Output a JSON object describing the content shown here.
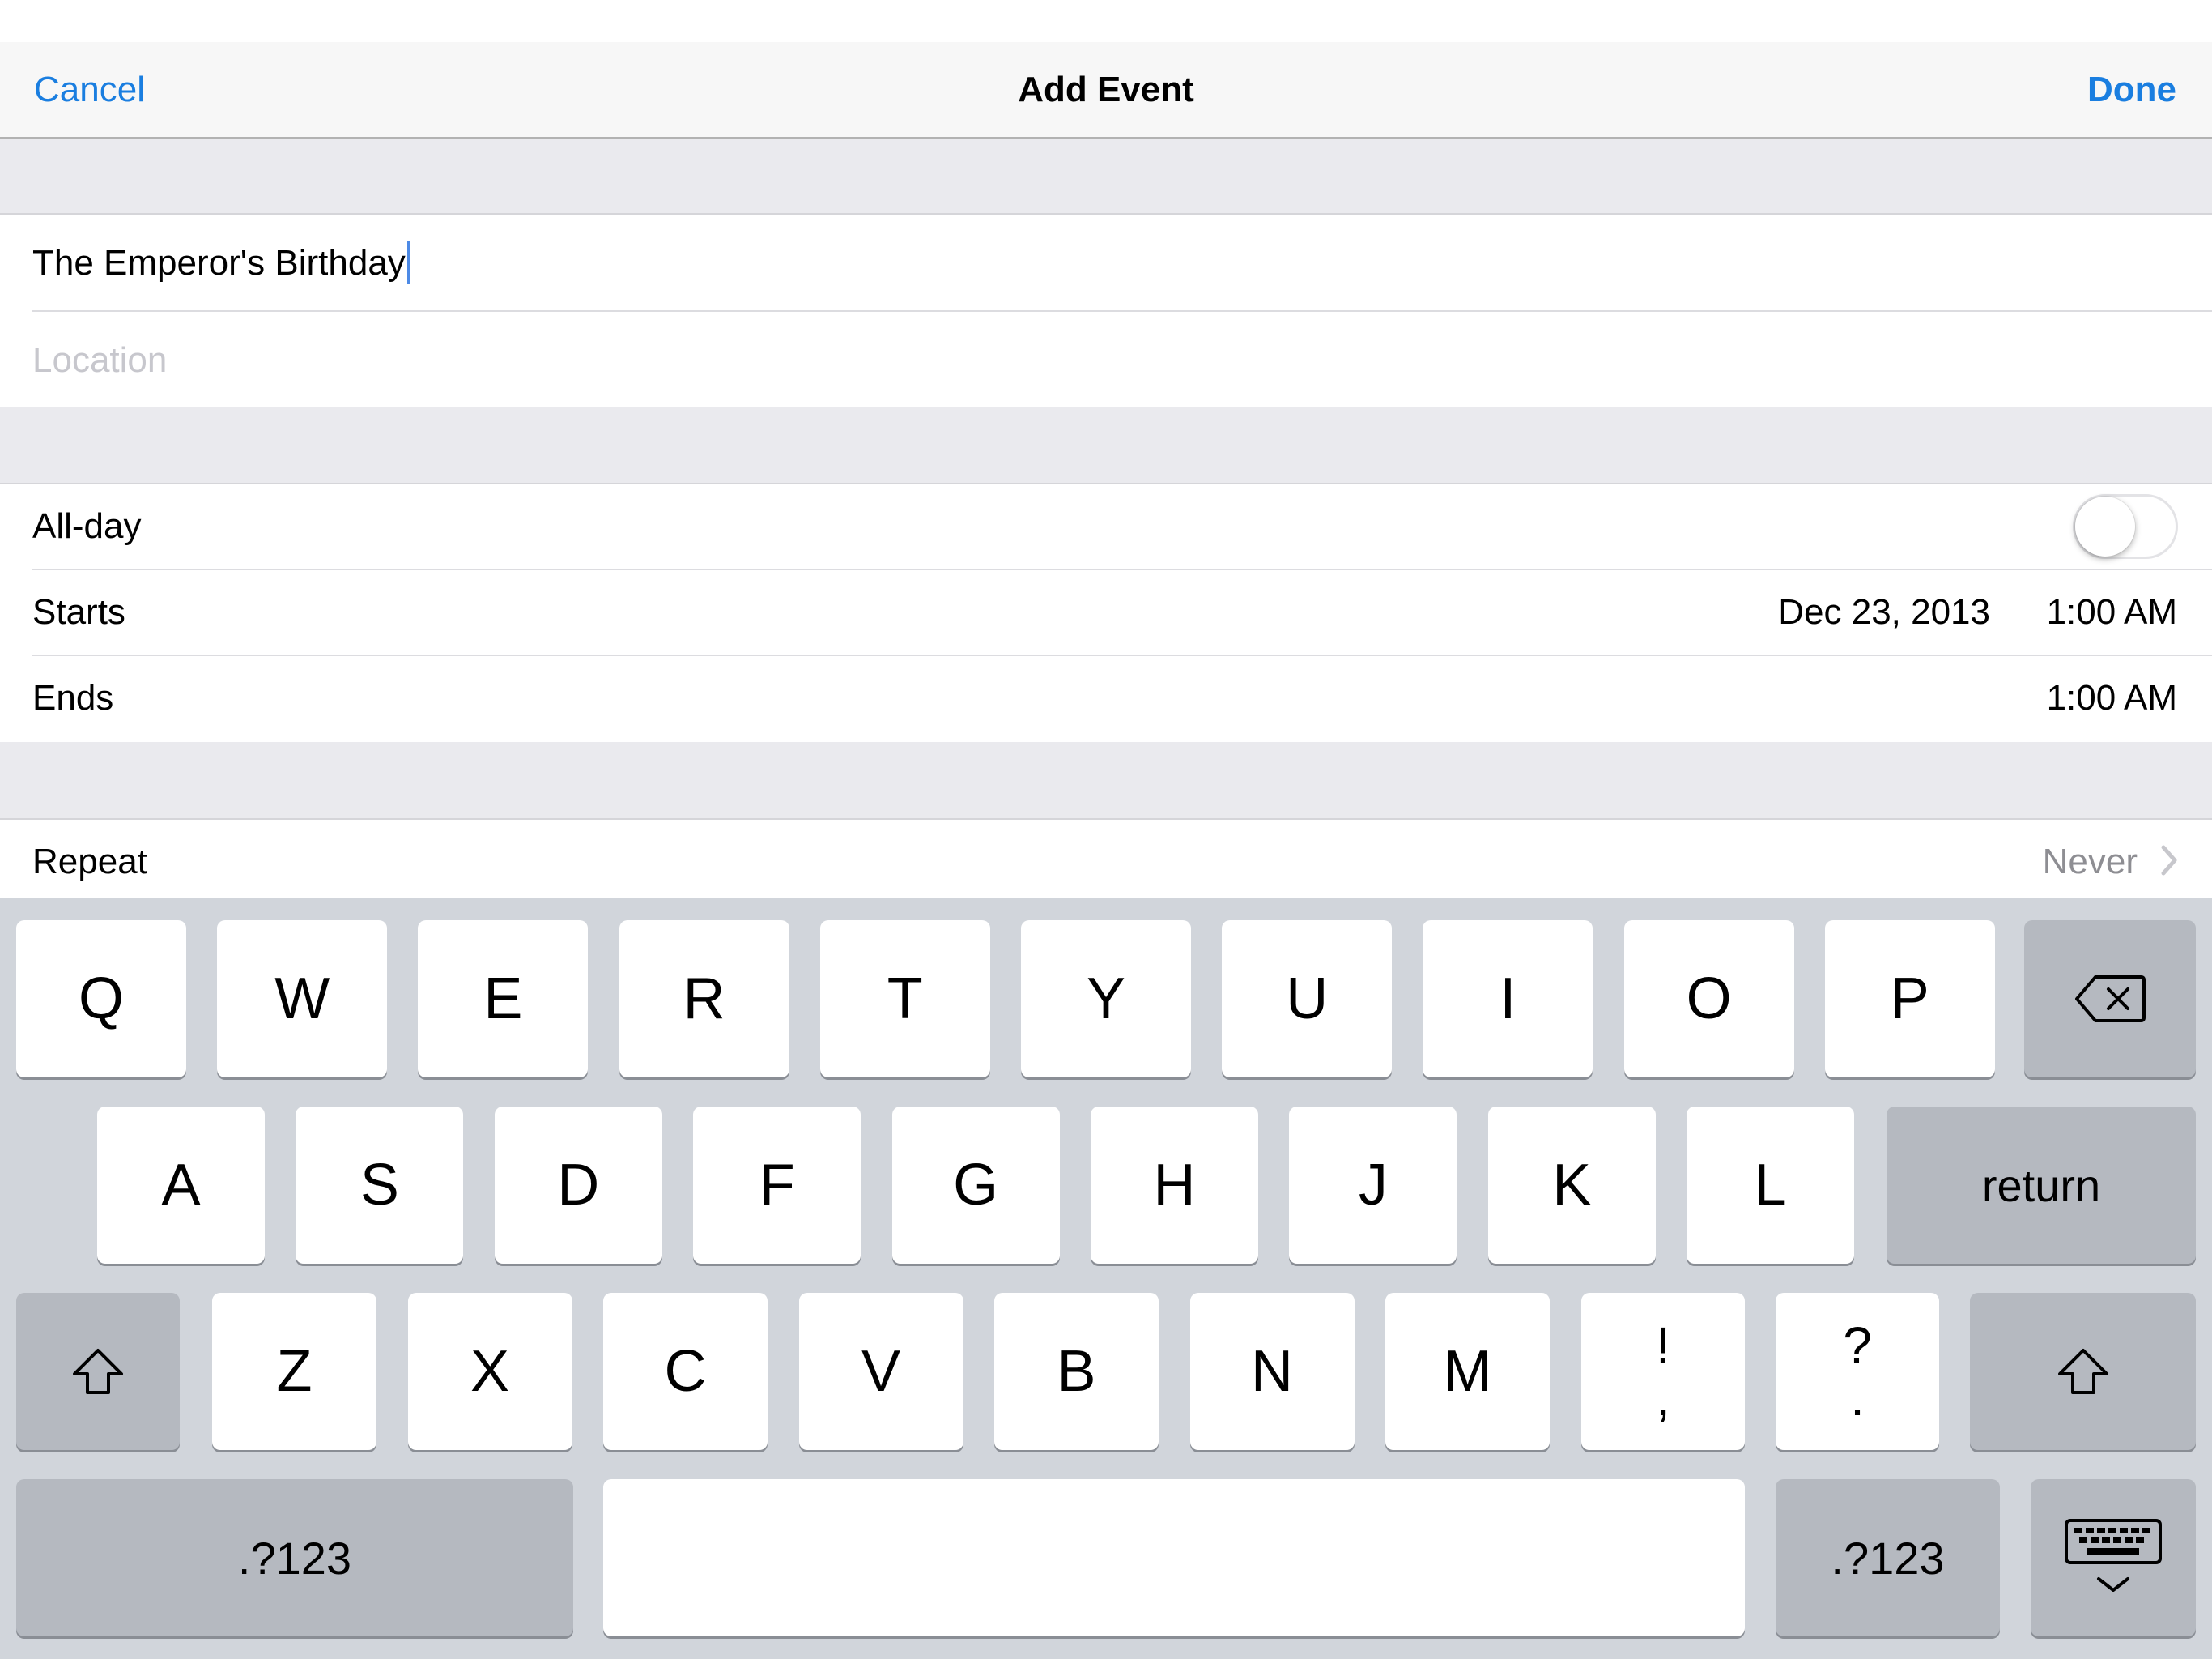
{
  "navbar": {
    "cancel_label": "Cancel",
    "title": "Add Event",
    "done_label": "Done",
    "accent_color": "#1a7ee0"
  },
  "event": {
    "title_value": "The Emperor's Birthday",
    "location_placeholder": "Location",
    "allday_label": "All-day",
    "allday_on": false,
    "starts_label": "Starts",
    "starts_date": "Dec 23, 2013",
    "starts_time": "1:00 AM",
    "ends_label": "Ends",
    "ends_time": "1:00 AM",
    "repeat_label": "Repeat",
    "repeat_value": "Never"
  },
  "keyboard": {
    "row1": [
      "Q",
      "W",
      "E",
      "R",
      "T",
      "Y",
      "U",
      "I",
      "O",
      "P"
    ],
    "row2": [
      "A",
      "S",
      "D",
      "F",
      "G",
      "H",
      "J",
      "K",
      "L"
    ],
    "row3": [
      "Z",
      "X",
      "C",
      "V",
      "B",
      "N",
      "M"
    ],
    "punct1_top": "!",
    "punct1_bottom": ",",
    "punct2_top": "?",
    "punct2_bottom": ".",
    "return_label": "return",
    "numbers_label": ".?123",
    "icons": [
      "delete-icon",
      "shift-icon",
      "keyboard-dismiss-icon"
    ]
  }
}
